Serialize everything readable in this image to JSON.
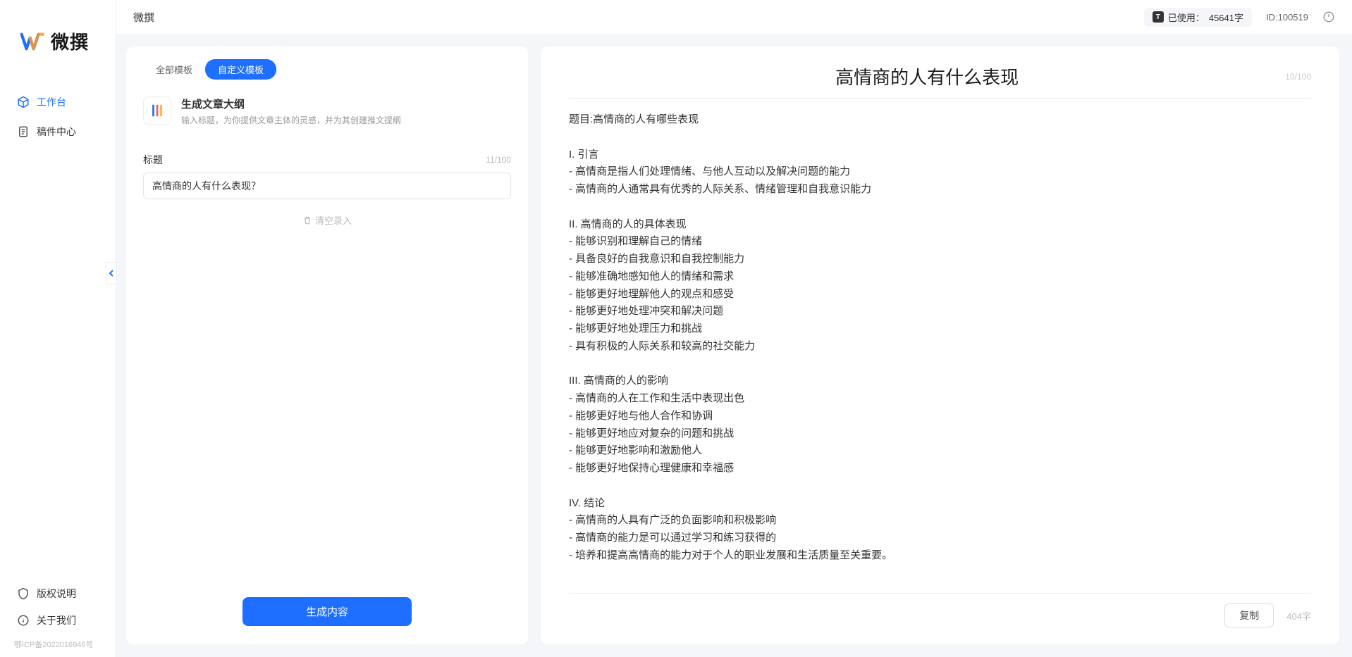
{
  "app": {
    "name": "微撰",
    "logo_label": "微撰"
  },
  "sidebar": {
    "nav": [
      {
        "label": "工作台",
        "active": true
      },
      {
        "label": "稿件中心",
        "active": false
      }
    ],
    "bottom": [
      {
        "label": "版权说明"
      },
      {
        "label": "关于我们"
      }
    ],
    "icp": "鄂ICP备2022016946号"
  },
  "header": {
    "title": "微撰",
    "usage_prefix": "已使用：",
    "usage_count": "45641字",
    "user_id": "ID:100519"
  },
  "left": {
    "tabs": [
      {
        "label": "全部模板",
        "active": false
      },
      {
        "label": "自定义模板",
        "active": true
      }
    ],
    "template": {
      "title": "生成文章大纲",
      "desc": "输入标题，为你提供文章主体的灵感，并为其创建推文提纲"
    },
    "field": {
      "label": "标题",
      "count": "11/100",
      "value": "高情商的人有什么表现？"
    },
    "clear_hint": "清空录入",
    "generate_btn": "生成内容"
  },
  "right": {
    "title": "高情商的人有什么表现",
    "title_count": "10/100",
    "content": "题目:高情商的人有哪些表现\n\nI. 引言\n- 高情商是指人们处理情绪、与他人互动以及解决问题的能力\n- 高情商的人通常具有优秀的人际关系、情绪管理和自我意识能力\n\nII. 高情商的人的具体表现\n- 能够识别和理解自己的情绪\n- 具备良好的自我意识和自我控制能力\n- 能够准确地感知他人的情绪和需求\n- 能够更好地理解他人的观点和感受\n- 能够更好地处理冲突和解决问题\n- 能够更好地处理压力和挑战\n- 具有积极的人际关系和较高的社交能力\n\nIII. 高情商的人的影响\n- 高情商的人在工作和生活中表现出色\n- 能够更好地与他人合作和协调\n- 能够更好地应对复杂的问题和挑战\n- 能够更好地影响和激励他人\n- 能够更好地保持心理健康和幸福感\n\nIV. 结论\n- 高情商的人具有广泛的负面影响和积极影响\n- 高情商的能力是可以通过学习和练习获得的\n- 培养和提高高情商的能力对于个人的职业发展和生活质量至关重要。",
    "copy_btn": "复制",
    "word_count": "404字"
  }
}
